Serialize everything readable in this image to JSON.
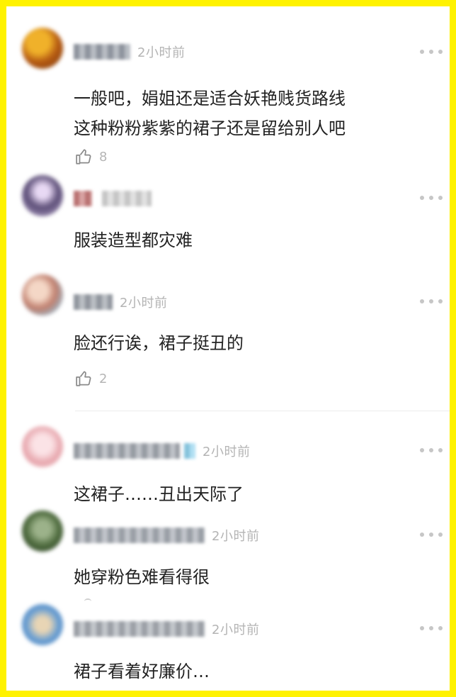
{
  "colors": {
    "frame": "#fff200",
    "time_text": "#b4b4b4",
    "comment_text": "#222222",
    "more_dots": "#c6c6c6"
  },
  "icons": {
    "more": "more-dots-icon",
    "like": "thumbs-up-icon"
  },
  "comments": [
    {
      "time": "2小时前",
      "lines": [
        "一般吧，娟姐还是适合妖艳贱货路线",
        "这种粉粉紫紫的裙子还是留给别人吧"
      ],
      "likes": "8"
    },
    {
      "time": "",
      "lines": [
        "服装造型都灾难"
      ],
      "likes": ""
    },
    {
      "time": "2小时前",
      "lines": [
        "脸还行诶，裙子挺丑的"
      ],
      "likes": "2"
    },
    {
      "time": "2小时前",
      "lines": [
        "这裙子……丑出天际了"
      ],
      "likes": ""
    },
    {
      "time": "2小时前",
      "lines": [
        "她穿粉色难看得很"
      ],
      "likes": ""
    },
    {
      "time": "2小时前",
      "lines": [
        "裙子看着好廉价…"
      ],
      "likes": ""
    }
  ]
}
